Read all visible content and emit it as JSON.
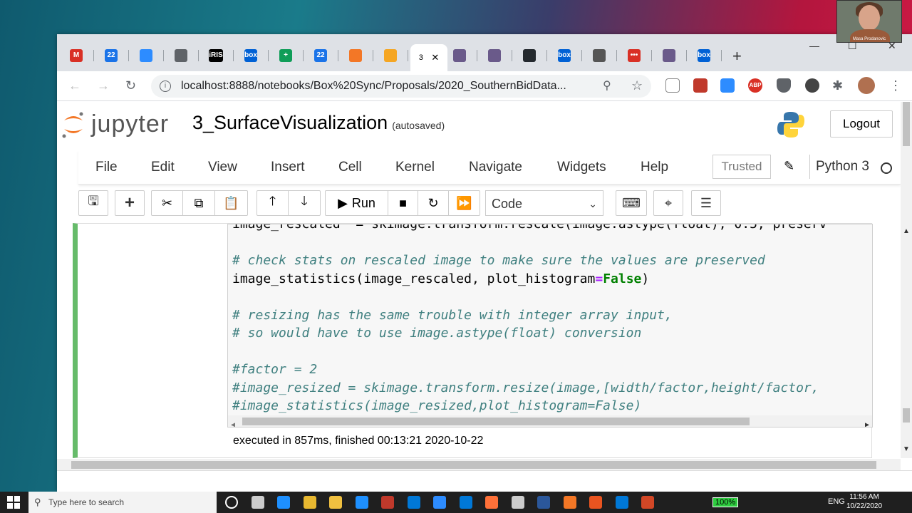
{
  "browser": {
    "tabs": [
      {
        "icon": "gmail-icon",
        "label": "M",
        "color": "#d93025"
      },
      {
        "icon": "calendar-icon",
        "label": "22",
        "color": "#1a73e8"
      },
      {
        "icon": "zoom-icon",
        "label": "",
        "color": "#2d8cff"
      },
      {
        "icon": "globe-icon",
        "label": "",
        "color": "#5f6368"
      },
      {
        "icon": "iris-icon",
        "label": "iRIS",
        "color": "#000000"
      },
      {
        "icon": "box-icon",
        "label": "box",
        "color": "#0061d5"
      },
      {
        "icon": "sheets-icon",
        "label": "+",
        "color": "#0f9d58"
      },
      {
        "icon": "calendar-icon",
        "label": "22",
        "color": "#1a73e8"
      },
      {
        "icon": "jupyter-icon",
        "label": "",
        "color": "#f37726"
      },
      {
        "icon": "notes-icon",
        "label": "",
        "color": "#f5a623"
      }
    ],
    "active_tab": {
      "label": "3",
      "close": "✕"
    },
    "tabs_right": [
      {
        "icon": "purple-app-icon",
        "label": "",
        "color": "#6a5a8a"
      },
      {
        "icon": "purple-app-icon",
        "label": "",
        "color": "#6a5a8a"
      },
      {
        "icon": "github-icon",
        "label": "",
        "color": "#24292e"
      },
      {
        "icon": "box-icon",
        "label": "box",
        "color": "#0061d5"
      },
      {
        "icon": "portrait-icon",
        "label": "",
        "color": "#555555"
      },
      {
        "icon": "red-dots-icon",
        "label": "•••",
        "color": "#d93025"
      },
      {
        "icon": "purple-app-icon",
        "label": "",
        "color": "#6a5a8a"
      },
      {
        "icon": "box-icon",
        "label": "box",
        "color": "#0061d5"
      }
    ],
    "new_tab": "+",
    "url": "localhost:8888/notebooks/Box%20Sync/Proposals/2020_SouthernBidData..."
  },
  "jupyter": {
    "logo_text": "jupyter",
    "notebook_name": "3_SurfaceVisualization",
    "autosave": "(autosaved)",
    "logout": "Logout",
    "menu": [
      "File",
      "Edit",
      "View",
      "Insert",
      "Cell",
      "Kernel",
      "Navigate",
      "Widgets",
      "Help"
    ],
    "trusted": "Trusted",
    "kernel": "Python 3",
    "run_label": "Run",
    "cell_type": "Code"
  },
  "code_lines": [
    [
      {
        "t": "image_rescaled  = skimage.transform.rescale(image.astype(float), 0.5, preserv",
        "c": "clip"
      }
    ],
    [
      {
        "t": "",
        "c": ""
      }
    ],
    [
      {
        "t": "# check stats on rescaled image to make sure the values are preserved",
        "c": "cm"
      }
    ],
    [
      {
        "t": "image_statistics(image_rescaled, plot_histogram",
        "c": ""
      },
      {
        "t": "=",
        "c": "op"
      },
      {
        "t": "False",
        "c": "kw"
      },
      {
        "t": ")",
        "c": ""
      }
    ],
    [
      {
        "t": "",
        "c": ""
      }
    ],
    [
      {
        "t": "# resizing has the same trouble with integer array input,",
        "c": "cm"
      }
    ],
    [
      {
        "t": "# so would have to use image.astype(float) conversion",
        "c": "cm"
      }
    ],
    [
      {
        "t": "",
        "c": ""
      }
    ],
    [
      {
        "t": "#factor = 2",
        "c": "cm"
      }
    ],
    [
      {
        "t": "#image_resized = skimage.transform.resize(image,[width/factor,height/factor,",
        "c": "cm"
      }
    ],
    [
      {
        "t": "#image_statistics(image_resized,plot_histogram=False)",
        "c": "cm"
      }
    ]
  ],
  "exec_status": "executed in 857ms, finished 00:13:21 2020-10-22",
  "webcam_name": "Masa Prodanovic",
  "taskbar": {
    "search_placeholder": "Type here to search",
    "battery": "100%",
    "lang": "ENG",
    "time": "11:56 AM",
    "date": "10/22/2020"
  }
}
